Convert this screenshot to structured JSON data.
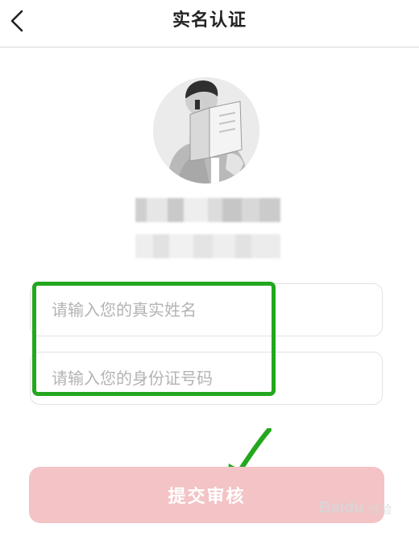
{
  "header": {
    "title": "实名认证",
    "back_icon": "chevron-left-icon"
  },
  "profile": {
    "avatar_icon": "person-reading-book-avatar"
  },
  "form": {
    "name_placeholder": "请输入您的真实姓名",
    "name_value": "",
    "id_placeholder": "请输入您的身份证号码",
    "id_value": ""
  },
  "submit": {
    "label": "提交审核",
    "color": "#f3c3c6"
  },
  "annotation": {
    "color": "#23a71e"
  },
  "watermark": {
    "text": "Baidu",
    "sub": "经验"
  }
}
